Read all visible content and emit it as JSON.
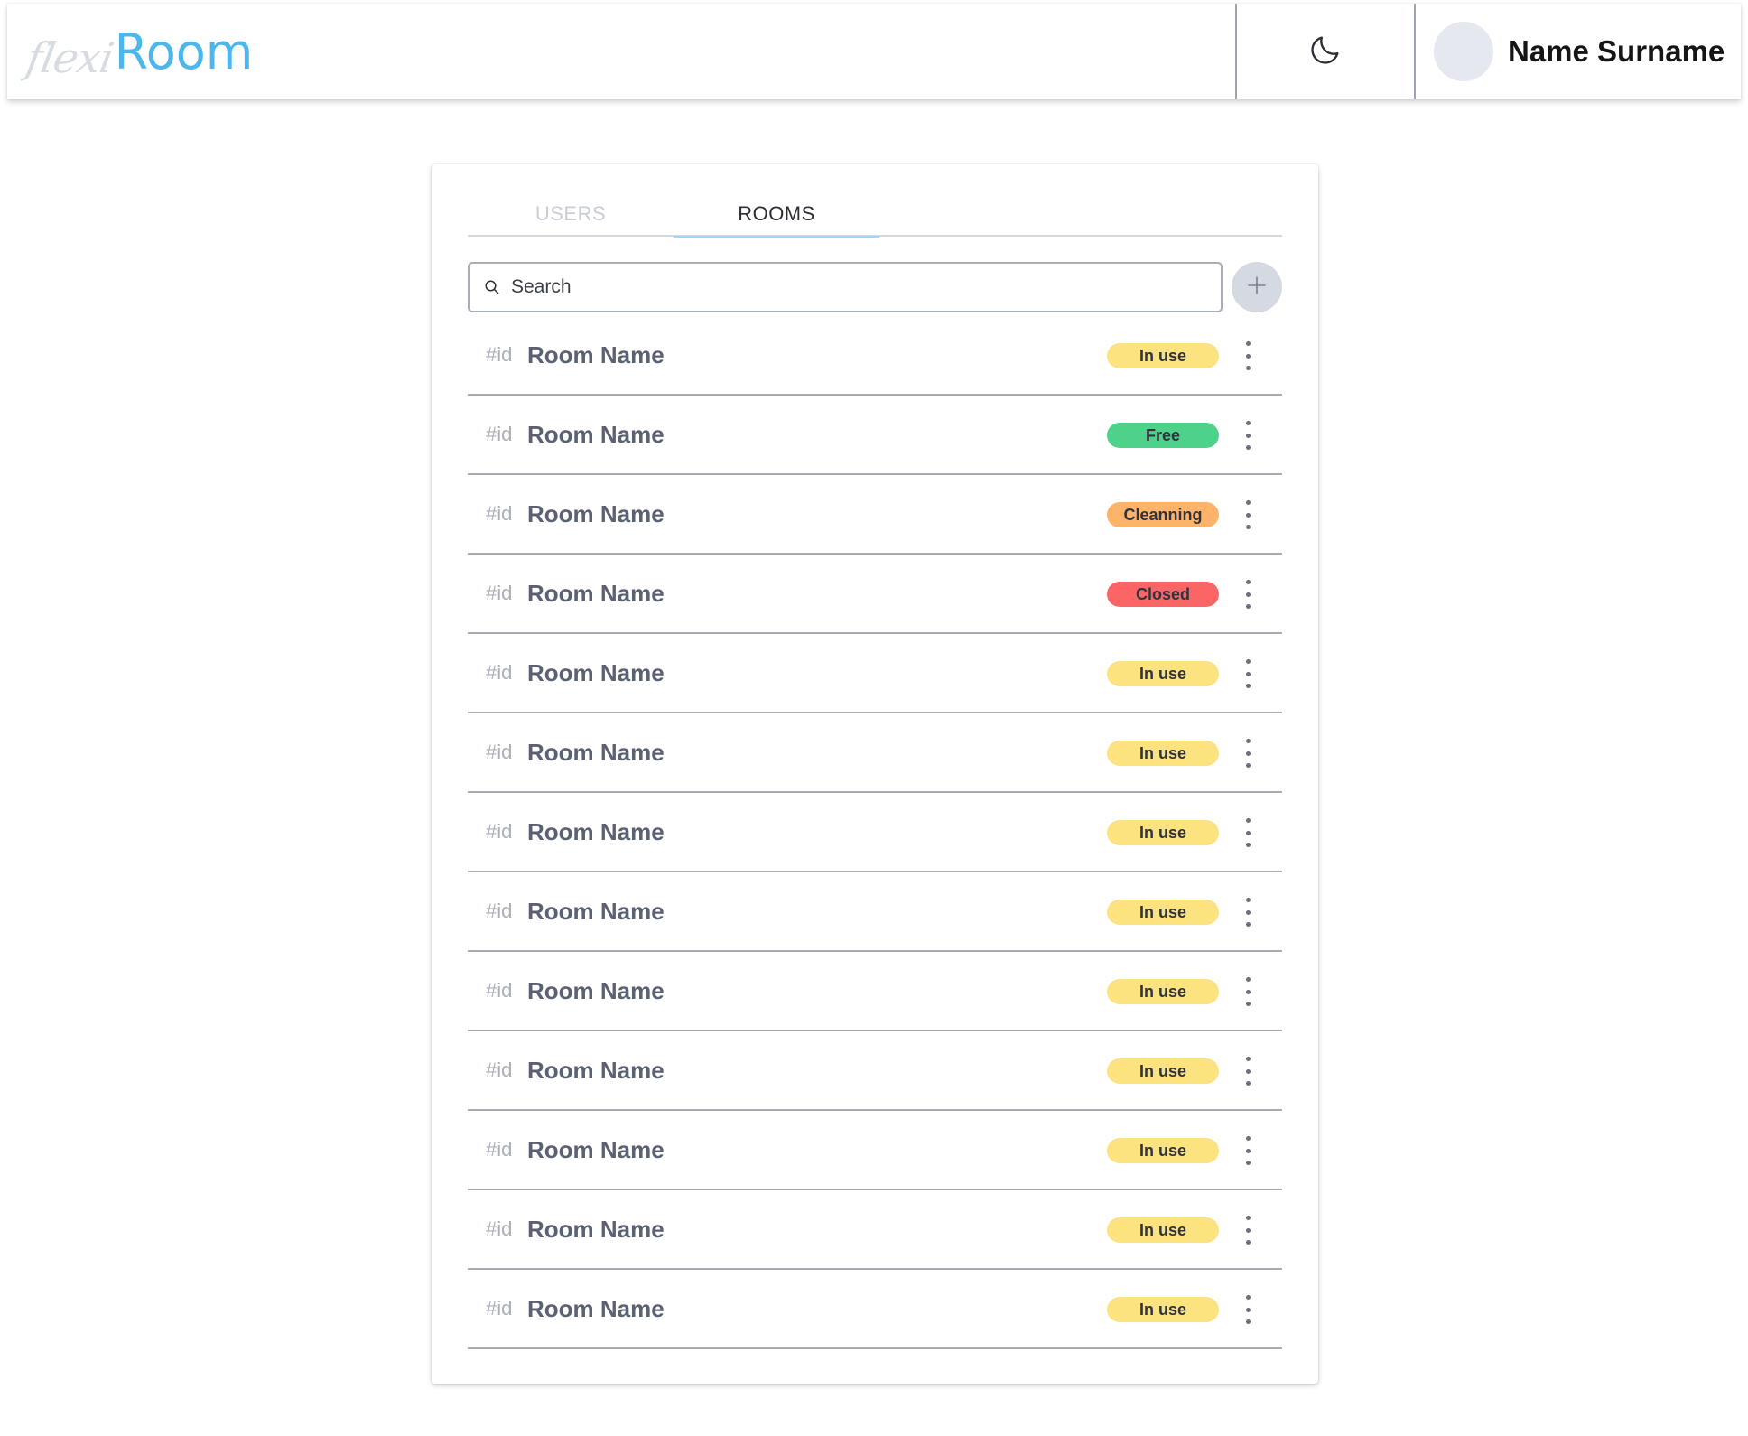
{
  "header": {
    "logo_script": "flexi",
    "logo_main": "Room",
    "theme_toggle_icon": "moon-icon",
    "user_name": "Name Surname"
  },
  "tabs": [
    {
      "label": "USERS",
      "active": false
    },
    {
      "label": "ROOMS",
      "active": true
    }
  ],
  "search": {
    "placeholder": "Search",
    "value": ""
  },
  "add_button_icon": "plus-icon",
  "status_colors": {
    "in-use": "#fde280",
    "free": "#4ed28a",
    "cleaning": "#fdb46a",
    "closed": "#fb6565"
  },
  "rooms": [
    {
      "id": "#id",
      "name": "Room Name",
      "status": "In use",
      "status_key": "in-use"
    },
    {
      "id": "#id",
      "name": "Room Name",
      "status": "Free",
      "status_key": "free"
    },
    {
      "id": "#id",
      "name": "Room Name",
      "status": "Cleanning",
      "status_key": "cleaning"
    },
    {
      "id": "#id",
      "name": "Room Name",
      "status": "Closed",
      "status_key": "closed"
    },
    {
      "id": "#id",
      "name": "Room Name",
      "status": "In use",
      "status_key": "in-use"
    },
    {
      "id": "#id",
      "name": "Room Name",
      "status": "In use",
      "status_key": "in-use"
    },
    {
      "id": "#id",
      "name": "Room Name",
      "status": "In use",
      "status_key": "in-use"
    },
    {
      "id": "#id",
      "name": "Room Name",
      "status": "In use",
      "status_key": "in-use"
    },
    {
      "id": "#id",
      "name": "Room Name",
      "status": "In use",
      "status_key": "in-use"
    },
    {
      "id": "#id",
      "name": "Room Name",
      "status": "In use",
      "status_key": "in-use"
    },
    {
      "id": "#id",
      "name": "Room Name",
      "status": "In use",
      "status_key": "in-use"
    },
    {
      "id": "#id",
      "name": "Room Name",
      "status": "In use",
      "status_key": "in-use"
    },
    {
      "id": "#id",
      "name": "Room Name",
      "status": "In use",
      "status_key": "in-use"
    }
  ]
}
